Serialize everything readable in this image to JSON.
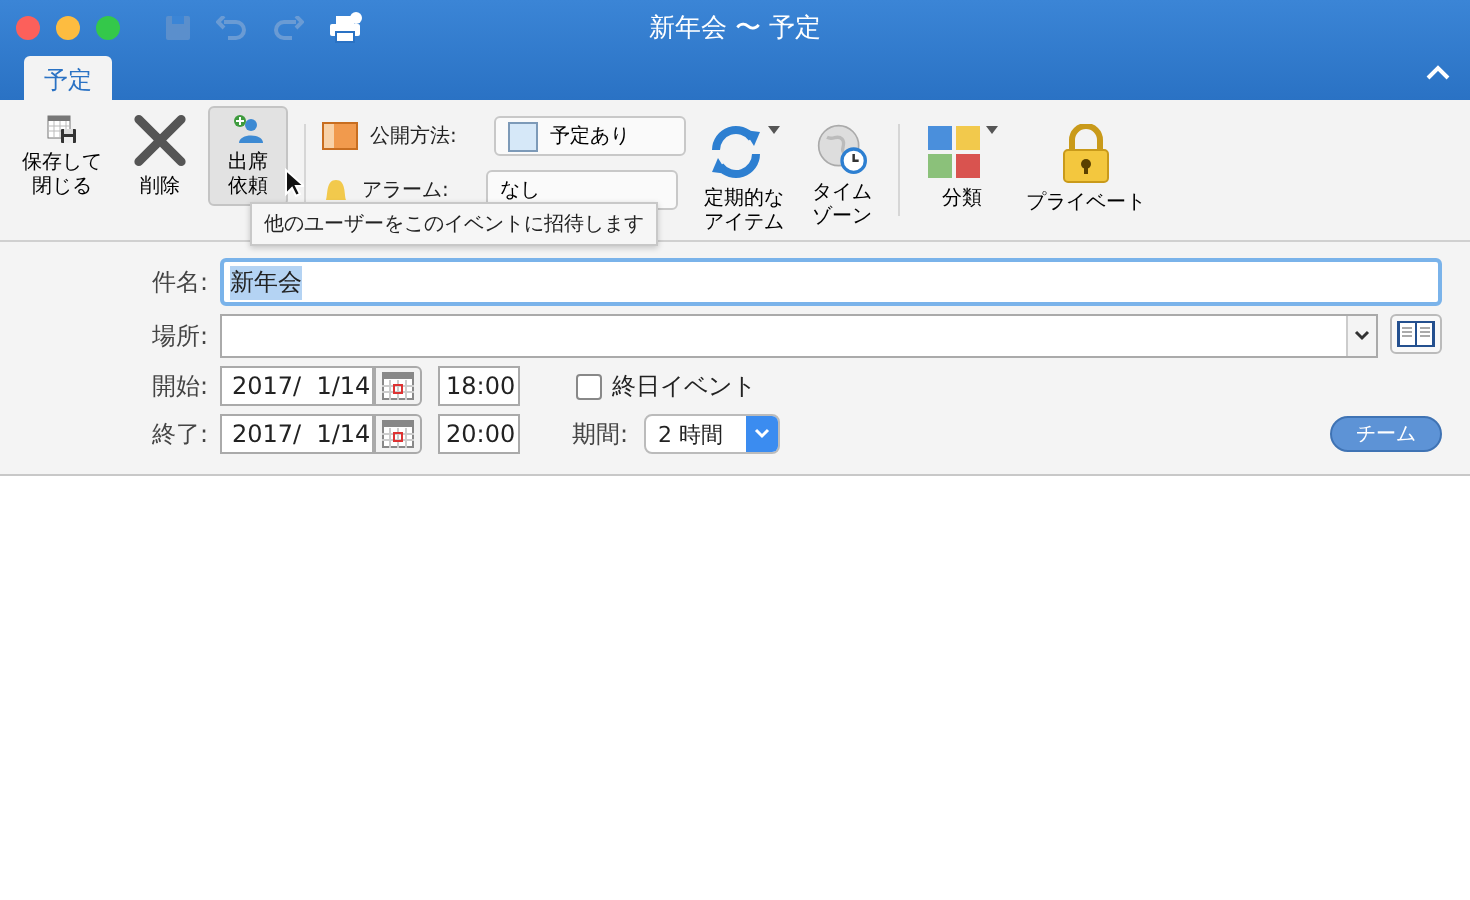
{
  "window": {
    "title": "新年会 〜 予定"
  },
  "tabs": [
    {
      "label": "予定",
      "selected": true
    }
  ],
  "ribbon": {
    "buttons": [
      {
        "kind": "save",
        "label": "保存して閉じる",
        "hovered": false,
        "has_menu": false
      },
      {
        "kind": "delete",
        "label": "削除",
        "hovered": false,
        "has_menu": false
      },
      {
        "kind": "invite",
        "label": "出席依頼",
        "hovered": true,
        "has_menu": false
      }
    ],
    "show_as": {
      "label": "公開方法:",
      "value": "予定あり"
    },
    "alarm": {
      "label": "アラーム:",
      "value": "なし"
    },
    "tools": [
      {
        "kind": "recurrence",
        "label": "定期的なアイテム",
        "has_menu": true
      },
      {
        "kind": "timezone",
        "label": "タイムゾーン",
        "has_menu": false
      }
    ],
    "tools2": [
      {
        "kind": "category",
        "label": "分類",
        "has_menu": true
      },
      {
        "kind": "private",
        "label": "プライベート",
        "has_menu": false
      }
    ],
    "tooltip": "他のユーザーをこのイベントに招待します"
  },
  "form": {
    "subject": {
      "label": "件名:",
      "value": "新年会",
      "focused": true
    },
    "location": {
      "label": "場所:"
    },
    "start": {
      "label": "開始:",
      "date": "2017/  1/14",
      "time": "18:00"
    },
    "end": {
      "label": "終了:",
      "date": "2017/  1/14",
      "time": "20:00"
    },
    "all_day": {
      "label": "終日イベント",
      "checked": false
    },
    "duration": {
      "label": "期間:",
      "value": "2 時間"
    },
    "team_button": "チーム"
  }
}
